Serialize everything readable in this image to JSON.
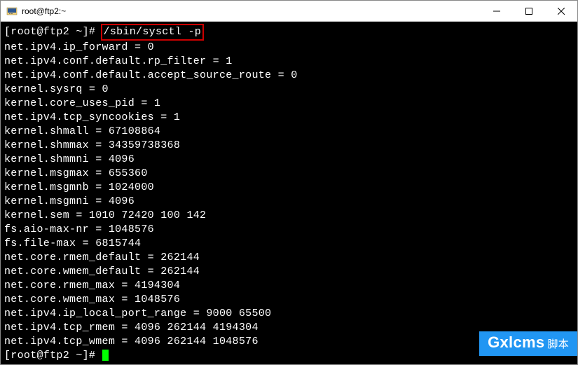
{
  "titlebar": {
    "title": "root@ftp2:~"
  },
  "terminal": {
    "prompt1": "[root@ftp2 ~]# ",
    "command": "/sbin/sysctl -p",
    "output_lines": [
      "net.ipv4.ip_forward = 0",
      "net.ipv4.conf.default.rp_filter = 1",
      "net.ipv4.conf.default.accept_source_route = 0",
      "kernel.sysrq = 0",
      "kernel.core_uses_pid = 1",
      "net.ipv4.tcp_syncookies = 1",
      "kernel.shmall = 67108864",
      "kernel.shmmax = 34359738368",
      "kernel.shmmni = 4096",
      "kernel.msgmax = 655360",
      "kernel.msgmnb = 1024000",
      "kernel.msgmni = 4096",
      "kernel.sem = 1010 72420 100 142",
      "fs.aio-max-nr = 1048576",
      "fs.file-max = 6815744",
      "net.core.rmem_default = 262144",
      "net.core.wmem_default = 262144",
      "net.core.rmem_max = 4194304",
      "net.core.wmem_max = 1048576",
      "net.ipv4.ip_local_port_range = 9000 65500",
      "net.ipv4.tcp_rmem = 4096 262144 4194304",
      "net.ipv4.tcp_wmem = 4096 262144 1048576"
    ],
    "prompt2": "[root@ftp2 ~]# "
  },
  "watermark": {
    "main": "Gxlcms",
    "sub": "脚本"
  }
}
